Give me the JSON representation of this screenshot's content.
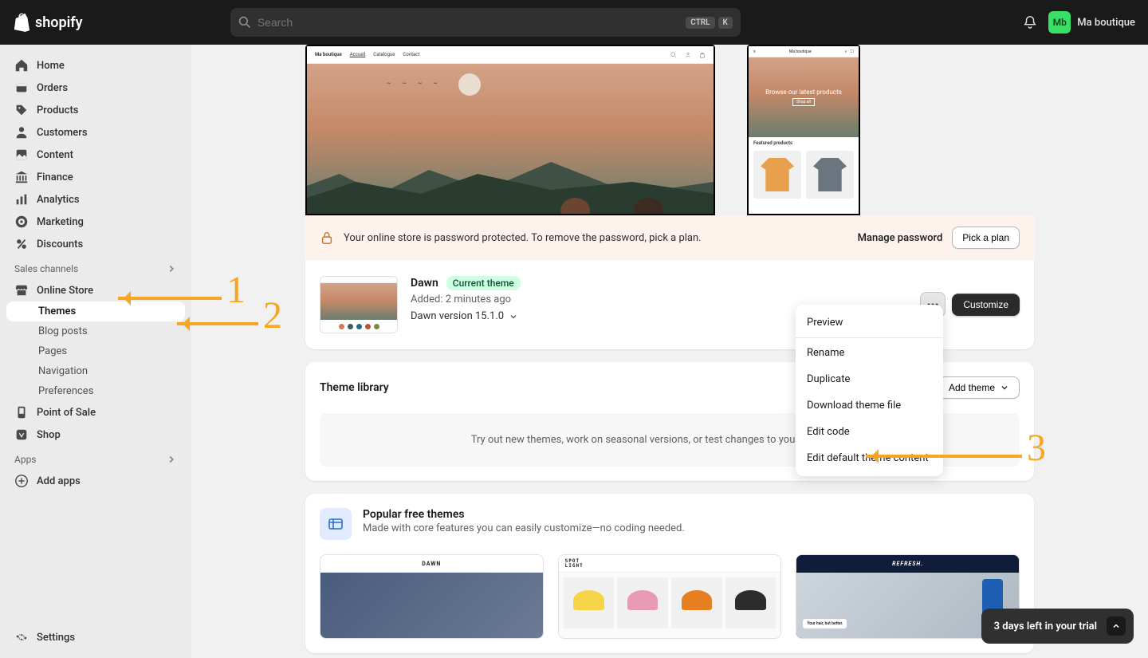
{
  "brand": "shopify",
  "search": {
    "placeholder": "Search",
    "kbd1": "CTRL",
    "kbd2": "K"
  },
  "store": {
    "avatar": "Mb",
    "name": "Ma boutique"
  },
  "nav": {
    "home": "Home",
    "orders": "Orders",
    "products": "Products",
    "customers": "Customers",
    "content": "Content",
    "finance": "Finance",
    "analytics": "Analytics",
    "marketing": "Marketing",
    "discounts": "Discounts",
    "sales_channels": "Sales channels",
    "online_store": "Online Store",
    "subs": {
      "themes": "Themes",
      "blog": "Blog posts",
      "pages": "Pages",
      "navigation": "Navigation",
      "preferences": "Preferences"
    },
    "pos": "Point of Sale",
    "shop": "Shop",
    "apps_label": "Apps",
    "add_apps": "Add apps",
    "settings": "Settings"
  },
  "preview": {
    "desktop": {
      "store_name": "Ma boutique",
      "tab_home": "Accueil",
      "tab_catalog": "Catalogue",
      "tab_contact": "Contact"
    },
    "mobile": {
      "store_name": "Ma boutique",
      "hero_text": "Browse our latest products",
      "cta": "Shop all",
      "featured": "Featured products"
    }
  },
  "pw_banner": {
    "text": "Your online store is password protected. To remove the password, pick a plan.",
    "manage": "Manage password",
    "pick": "Pick a plan"
  },
  "theme": {
    "name": "Dawn",
    "badge": "Current theme",
    "added_label": "Added: 2 minutes ago",
    "version": "Dawn version 15.1.0",
    "customize": "Customize"
  },
  "dropdown": {
    "preview": "Preview",
    "rename": "Rename",
    "duplicate": "Duplicate",
    "download": "Download theme file",
    "edit_code": "Edit code",
    "edit_default": "Edit default theme content"
  },
  "library": {
    "title": "Theme library",
    "add": "Add theme",
    "empty": "Try out new themes, work on seasonal versions, or test changes to your current theme."
  },
  "popular": {
    "title": "Popular free themes",
    "sub": "Made with core features you can easily customize—no coding needed.",
    "themes": {
      "dawn": "DAWN",
      "spotlight": "SPOT\nLIGHT",
      "refresh": "REFRESH.",
      "refresh_cta": "Your hair, but better."
    }
  },
  "trial": {
    "text": "3 days left in your trial"
  },
  "colors": {
    "annotation": "#f5a623",
    "thumb_dots": [
      "#d47a56",
      "#3e5c5a",
      "#2a6e7c",
      "#b3563a",
      "#7a8a3e"
    ]
  },
  "annotations": {
    "n1": "1",
    "n2": "2",
    "n3": "3"
  }
}
